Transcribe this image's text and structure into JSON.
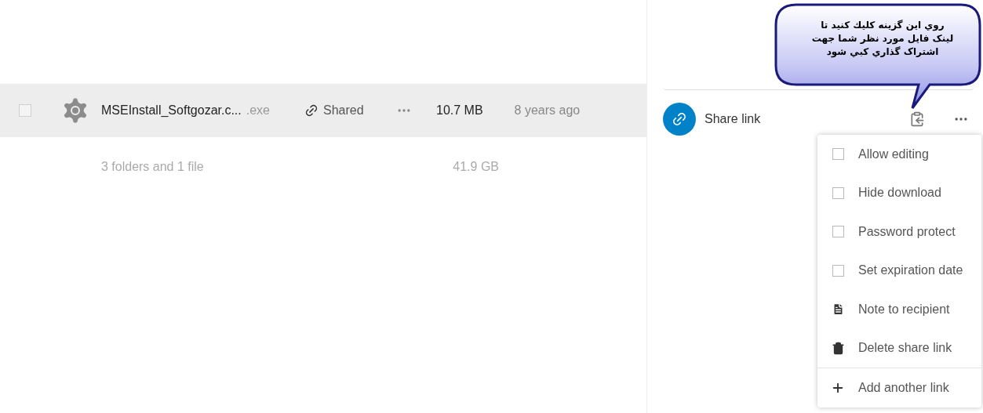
{
  "file_row": {
    "selected": false,
    "name": "MSEInstall_Softgozar.c...",
    "extension": ".exe",
    "share_label": "Shared",
    "size": "10.7 MB",
    "modified": "8 years ago"
  },
  "summary": {
    "text": "3 folders and 1 file",
    "size": "41.9 GB"
  },
  "share_link": {
    "label": "Share link"
  },
  "callout": {
    "lines": [
      "روي اين گزينه كليك كنيد تا",
      "لينک فايل مورد نظر شما جهت",
      "اشتراک گذاري کبي شود"
    ]
  },
  "menu_items": [
    {
      "kind": "checkbox",
      "label": "Allow editing",
      "checked": false
    },
    {
      "kind": "checkbox",
      "label": "Hide download",
      "checked": false
    },
    {
      "kind": "checkbox",
      "label": "Password protect",
      "checked": false
    },
    {
      "kind": "checkbox",
      "label": "Set expiration date",
      "checked": false
    },
    {
      "kind": "note",
      "label": "Note to recipient"
    },
    {
      "kind": "delete",
      "label": "Delete share link"
    },
    {
      "kind": "add",
      "label": "Add another link"
    }
  ]
}
